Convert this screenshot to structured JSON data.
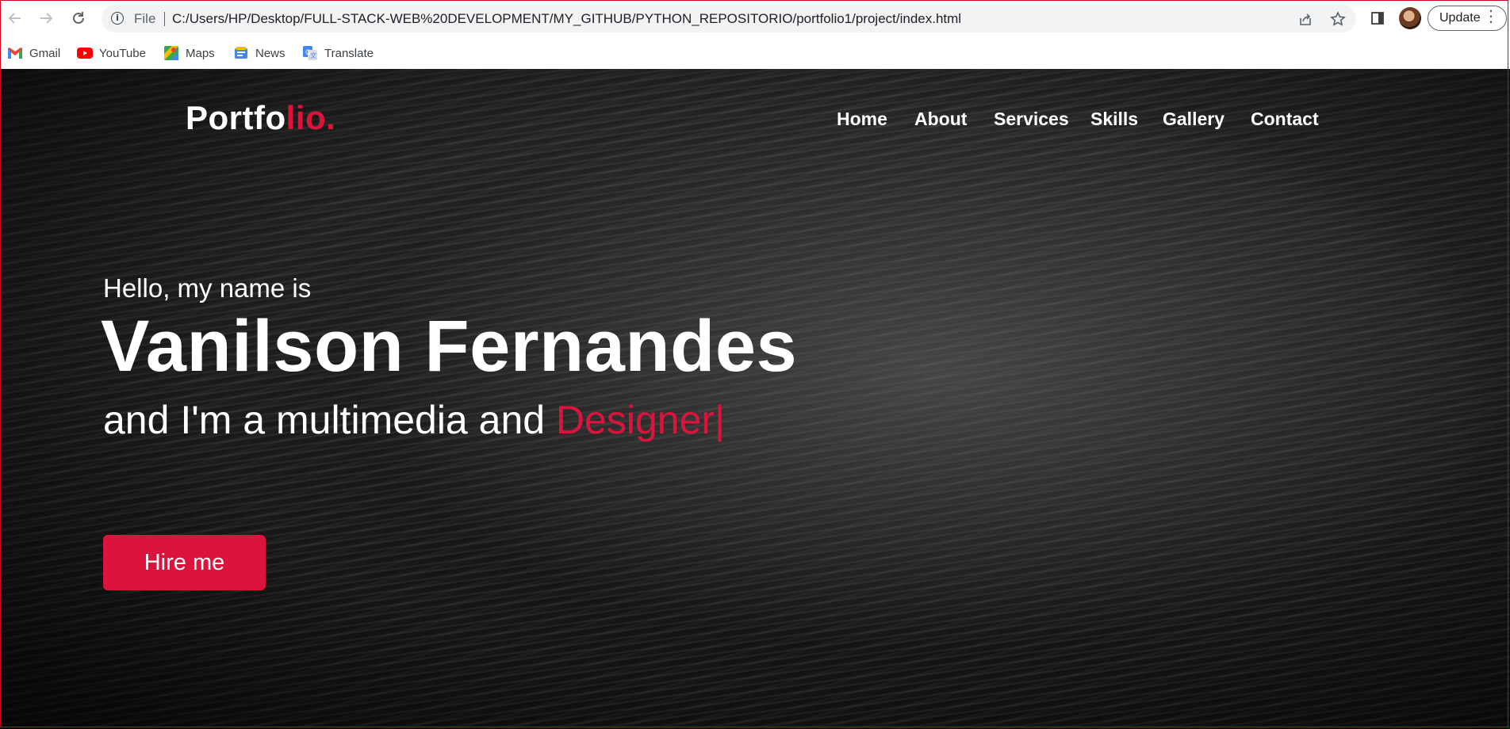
{
  "browser": {
    "url_scheme": "File",
    "url": "C:/Users/HP/Desktop/FULL-STACK-WEB%20DEVELOPMENT/MY_GITHUB/PYTHON_REPOSITORIO/portfolio1/project/index.html",
    "update_label": "Update",
    "bookmarks": [
      {
        "label": "Gmail",
        "icon": "gmail-icon"
      },
      {
        "label": "YouTube",
        "icon": "youtube-icon"
      },
      {
        "label": "Maps",
        "icon": "maps-icon"
      },
      {
        "label": "News",
        "icon": "news-icon"
      },
      {
        "label": "Translate",
        "icon": "translate-icon"
      }
    ]
  },
  "site": {
    "logo_main": "Portfo",
    "logo_accent": "lio.",
    "nav": [
      "Home",
      "About",
      "Services",
      "Skills",
      "Gallery",
      "Contact"
    ],
    "greeting": "Hello, my name is",
    "name": "Vanilson Fernandes",
    "subtitle_prefix": "and I'm a multimedia and ",
    "subtitle_typed": "Designer|",
    "hire_label": "Hire me"
  },
  "colors": {
    "accent": "#dc143c",
    "text": "#ffffff",
    "background": "#1f1f1f"
  }
}
